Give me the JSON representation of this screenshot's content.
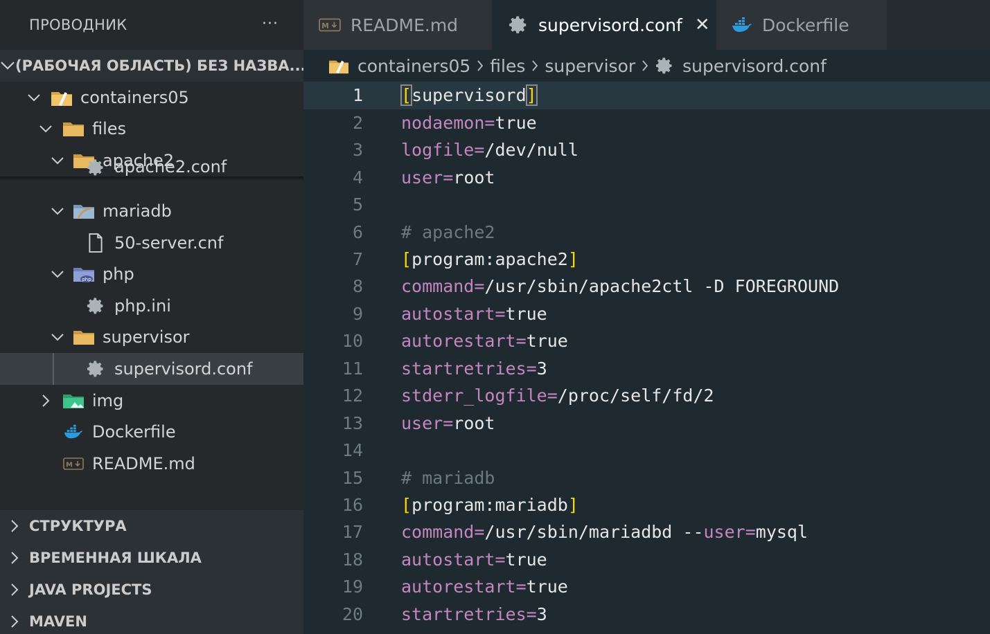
{
  "sidebar": {
    "title": "ПРОВОДНИК",
    "more": "···",
    "workspace": "(РАБОЧАЯ ОБЛАСТЬ) БЕЗ НАЗВА...",
    "tree": [
      {
        "label": "containers05",
        "type": "folder-open",
        "icon": "vscode-folder-icon"
      },
      {
        "label": "files",
        "type": "folder-open",
        "icon": "folder-icon"
      },
      {
        "label": "apache2",
        "type": "folder-open",
        "icon": "folder-icon"
      },
      {
        "label": "apache2.conf",
        "type": "file",
        "icon": "gear-icon"
      },
      {
        "label": "mariadb",
        "type": "folder-open",
        "icon": "mariadb-folder-icon"
      },
      {
        "label": "50-server.cnf",
        "type": "file",
        "icon": "file-icon"
      },
      {
        "label": "php",
        "type": "folder-open",
        "icon": "php-folder-icon"
      },
      {
        "label": "php.ini",
        "type": "file",
        "icon": "gear-icon"
      },
      {
        "label": "supervisor",
        "type": "folder-open",
        "icon": "folder-icon"
      },
      {
        "label": "supervisord.conf",
        "type": "file",
        "icon": "gear-icon",
        "selected": true
      },
      {
        "label": "img",
        "type": "folder-closed",
        "icon": "image-folder-icon"
      },
      {
        "label": "Dockerfile",
        "type": "file",
        "icon": "docker-icon"
      },
      {
        "label": "README.md",
        "type": "file",
        "icon": "markdown-icon"
      }
    ],
    "panels": [
      "СТРУКТУРА",
      "ВРЕМЕННАЯ ШКАЛА",
      "JAVA PROJECTS",
      "MAVEN"
    ]
  },
  "tabs": [
    {
      "label": "README.md",
      "icon": "markdown-icon",
      "active": false
    },
    {
      "label": "supervisord.conf",
      "icon": "gear-icon",
      "active": true,
      "close": "✕"
    },
    {
      "label": "Dockerfile",
      "icon": "docker-icon",
      "active": false
    }
  ],
  "breadcrumb": [
    "containers05",
    "files",
    "supervisor",
    "supervisord.conf"
  ],
  "editor": {
    "lines": [
      {
        "n": "1",
        "kind": "section",
        "text": "supervisord",
        "current": true
      },
      {
        "n": "2",
        "kind": "kv",
        "key": "nodaemon",
        "val": "true"
      },
      {
        "n": "3",
        "kind": "kv",
        "key": "logfile",
        "val": "/dev/null"
      },
      {
        "n": "4",
        "kind": "kv",
        "key": "user",
        "val": "root"
      },
      {
        "n": "5",
        "kind": "empty"
      },
      {
        "n": "6",
        "kind": "comment",
        "text": "# apache2"
      },
      {
        "n": "7",
        "kind": "section",
        "text": "program:apache2"
      },
      {
        "n": "8",
        "kind": "kv",
        "key": "command",
        "val": "/usr/sbin/apache2ctl -D FOREGROUND"
      },
      {
        "n": "9",
        "kind": "kv",
        "key": "autostart",
        "val": "true"
      },
      {
        "n": "10",
        "kind": "kv",
        "key": "autorestart",
        "val": "true"
      },
      {
        "n": "11",
        "kind": "kv",
        "key": "startretries",
        "val": "3"
      },
      {
        "n": "12",
        "kind": "kv",
        "key": "stderr_logfile",
        "val": "/proc/self/fd/2"
      },
      {
        "n": "13",
        "kind": "kv",
        "key": "user",
        "val": "root"
      },
      {
        "n": "14",
        "kind": "empty"
      },
      {
        "n": "15",
        "kind": "comment",
        "text": "# mariadb"
      },
      {
        "n": "16",
        "kind": "section",
        "text": "program:mariadb"
      },
      {
        "n": "17",
        "kind": "kv2",
        "key": "command",
        "val": "/usr/sbin/mariadbd --",
        "key2": "user",
        "val2": "mysql"
      },
      {
        "n": "18",
        "kind": "kv",
        "key": "autostart",
        "val": "true"
      },
      {
        "n": "19",
        "kind": "kv",
        "key": "autorestart",
        "val": "true"
      },
      {
        "n": "20",
        "kind": "kv",
        "key": "startretries",
        "val": "3"
      }
    ]
  },
  "colors": {
    "accent_key": "#c586c0",
    "bracket": "#ffd700",
    "comment": "#6a7a80",
    "editor_bg": "#1e2a30"
  }
}
